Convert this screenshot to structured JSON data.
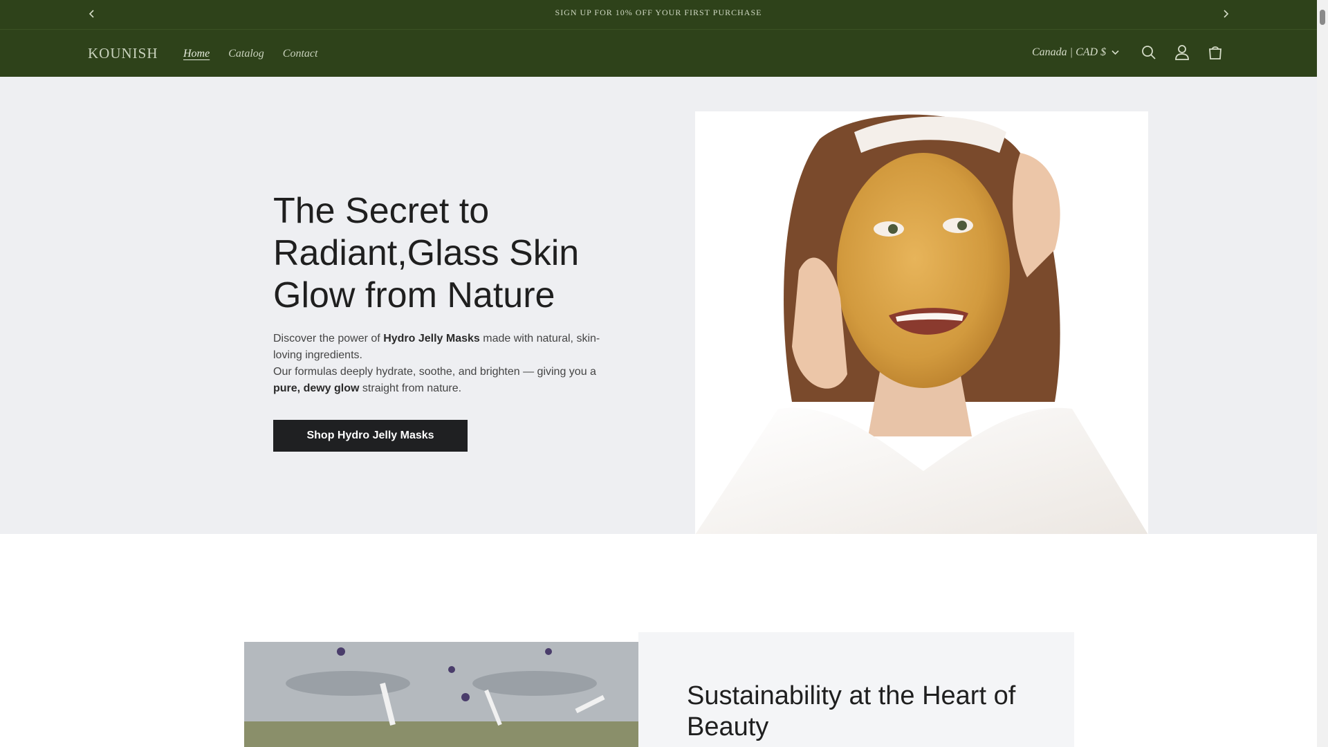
{
  "announcement": {
    "text": "SIGN UP FOR 10% OFF YOUR FIRST PURCHASE"
  },
  "header": {
    "logo": "KOUNISH",
    "nav": [
      {
        "label": "Home",
        "active": true
      },
      {
        "label": "Catalog",
        "active": false
      },
      {
        "label": "Contact",
        "active": false
      }
    ],
    "locale": "Canada | CAD $",
    "icons": [
      "search-icon",
      "account-icon",
      "cart-icon"
    ]
  },
  "hero": {
    "title": "The Secret to Radiant,Glass Skin Glow from Nature",
    "desc_1a": "Discover the power of ",
    "desc_1b": "Hydro Jelly Masks",
    "desc_1c": " made with natural, skin-loving ingredients.",
    "desc_2a": "Our formulas deeply hydrate, soothe, and brighten — giving you a ",
    "desc_2b": "pure, dewy glow",
    "desc_2c": " straight from nature.",
    "cta": "Shop Hydro Jelly Masks"
  },
  "section2": {
    "title": "Sustainability at the Heart of Beauty"
  },
  "colors": {
    "header_bg": "#2e421a",
    "hero_bg": "#eeeff2",
    "button_bg": "#1f2022"
  }
}
